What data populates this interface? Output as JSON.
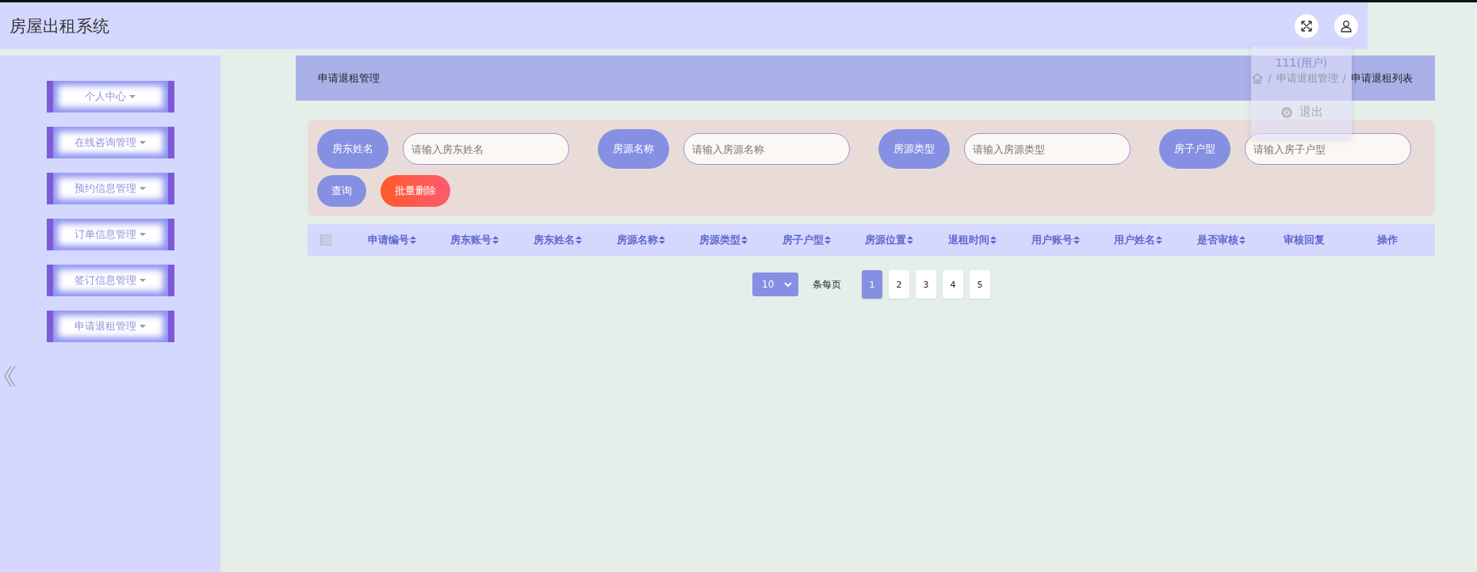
{
  "header": {
    "title": "房屋出租系统"
  },
  "user_menu": {
    "user": "111(用户)",
    "logout": "退出"
  },
  "sidebar": {
    "items": [
      {
        "label": "个人中心"
      },
      {
        "label": "在线咨询管理"
      },
      {
        "label": "预约信息管理"
      },
      {
        "label": "订单信息管理"
      },
      {
        "label": "签订信息管理"
      },
      {
        "label": "申请退租管理"
      }
    ]
  },
  "page_title": "申请退租管理",
  "breadcrumb": {
    "separator": "/",
    "items": [
      "申请退租管理",
      "申请退租列表"
    ]
  },
  "search": {
    "fields": [
      {
        "label": "房东姓名",
        "placeholder": "请输入房东姓名"
      },
      {
        "label": "房源名称",
        "placeholder": "请输入房源名称"
      },
      {
        "label": "房源类型",
        "placeholder": "请输入房源类型"
      },
      {
        "label": "房子户型",
        "placeholder": "请输入房子户型"
      }
    ],
    "buttons": [
      {
        "label": "查询",
        "kind": "query"
      },
      {
        "label": "批量删除",
        "kind": "delete"
      }
    ]
  },
  "table": {
    "select_all": {
      "checked": false
    },
    "columns": [
      {
        "label": "申请编号",
        "sortable": true
      },
      {
        "label": "房东账号",
        "sortable": true
      },
      {
        "label": "房东姓名",
        "sortable": true
      },
      {
        "label": "房源名称",
        "sortable": true
      },
      {
        "label": "房源类型",
        "sortable": true
      },
      {
        "label": "房子户型",
        "sortable": true
      },
      {
        "label": "房源位置",
        "sortable": true
      },
      {
        "label": "退租时间",
        "sortable": true
      },
      {
        "label": "用户账号",
        "sortable": true
      },
      {
        "label": "用户姓名",
        "sortable": true
      },
      {
        "label": "是否审核",
        "sortable": true
      },
      {
        "label": "审核回复",
        "sortable": false
      },
      {
        "label": "操作",
        "sortable": false
      }
    ]
  },
  "pagination": {
    "page_size": "10",
    "page_size_label": "条每页",
    "pages": [
      {
        "label": "1",
        "selected": true
      },
      {
        "label": "2",
        "selected": false
      },
      {
        "label": "3",
        "selected": false
      },
      {
        "label": "4",
        "selected": false
      },
      {
        "label": "5",
        "selected": false
      }
    ]
  }
}
